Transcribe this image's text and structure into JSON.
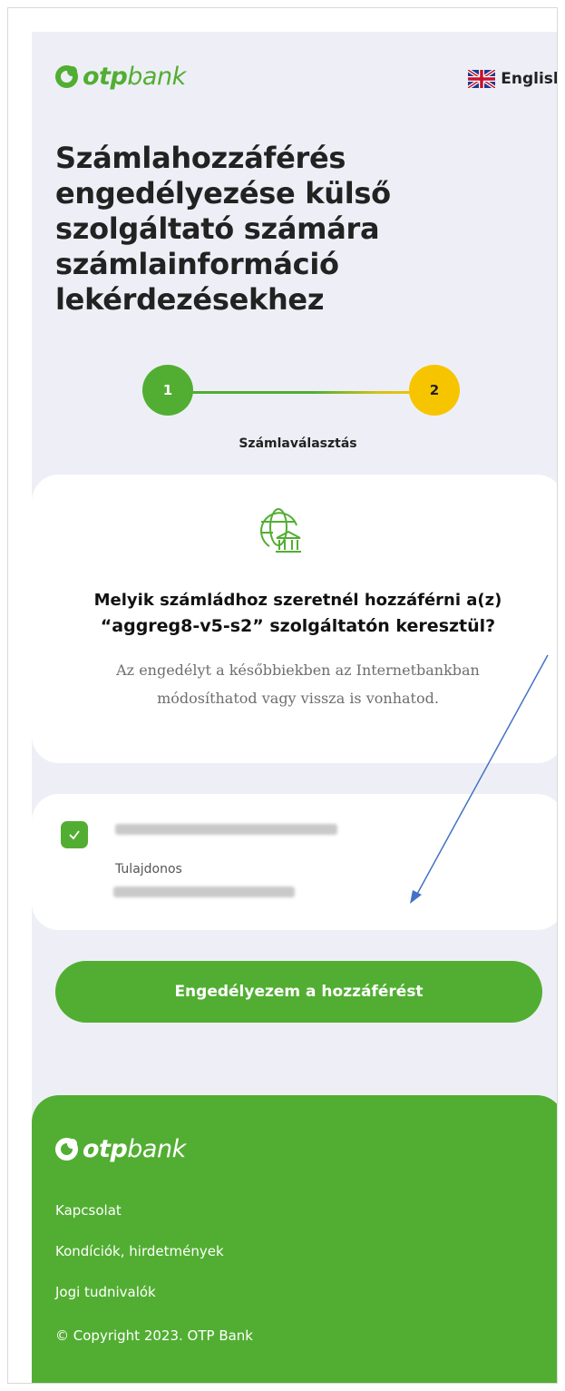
{
  "header": {
    "logo_otp": "otp",
    "logo_bank": "bank",
    "language_label": "English"
  },
  "page_title": "Számlahozzáférés engedélyezése külső szolgáltató számára számlainformáció lekérdezésekhez",
  "stepper": {
    "step1": "1",
    "step2": "2",
    "current_label": "Számlaválasztás"
  },
  "info_card": {
    "question_line1": "Melyik számládhoz szeretnél hozzáférni a(z)",
    "question_line2": "“aggreg8-v5-s2” szolgáltatón keresztül?",
    "note": "Az engedélyt a későbbiekben az Internetbankban módosíthatod vagy vissza is vonhatod."
  },
  "account_card": {
    "checked": true,
    "owner_label": "Tulajdonos"
  },
  "cta_label": "Engedélyezem a hozzáférést",
  "footer": {
    "logo_otp": "otp",
    "logo_bank": "bank",
    "links": [
      "Kapcsolat",
      "Kondíciók, hirdetmények",
      "Jogi tudnivalók"
    ],
    "copyright": "© Copyright 2023. OTP Bank"
  },
  "colors": {
    "brand_green": "#52ae32",
    "step_yellow": "#f7c500",
    "background": "#eeeff6",
    "annotation_arrow": "#4472c4"
  },
  "icons": [
    "otp-logo-icon",
    "uk-flag-icon",
    "globe-bank-icon",
    "checkmark-icon"
  ]
}
